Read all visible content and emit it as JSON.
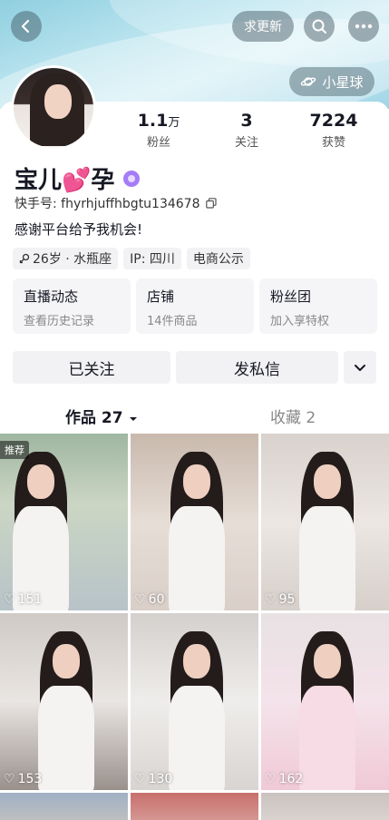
{
  "header": {
    "request_update_label": "求更新",
    "planet_label": "小星球"
  },
  "profile": {
    "name": "宝儿💕孕",
    "kuaishou_id": "快手号: fhyrhjuffhbgtu134678",
    "bio": "感谢平台给予我机会!",
    "stats": [
      {
        "num": "1.1",
        "unit": "万",
        "label": "粉丝"
      },
      {
        "num": "3",
        "unit": "",
        "label": "关注"
      },
      {
        "num": "7224",
        "unit": "",
        "label": "获赞"
      }
    ],
    "tags": [
      "26岁 · 水瓶座",
      "IP: 四川",
      "电商公示"
    ]
  },
  "cards": [
    {
      "title": "直播动态",
      "sub": "查看历史记录"
    },
    {
      "title": "店铺",
      "sub": "14件商品"
    },
    {
      "title": "粉丝团",
      "sub": "加入享特权"
    }
  ],
  "actions": {
    "followed_label": "已关注",
    "message_label": "发私信"
  },
  "tabs": {
    "works_label": "作品 27",
    "favorites_label": "收藏 2"
  },
  "grid": {
    "pinned_label": "推荐",
    "likes": [
      "151",
      "60",
      "95",
      "153",
      "130",
      "162"
    ]
  },
  "colors": {
    "banner": "#a9dcea",
    "badge": "#a57cf7",
    "panel_bg": "#f5f5f7"
  }
}
